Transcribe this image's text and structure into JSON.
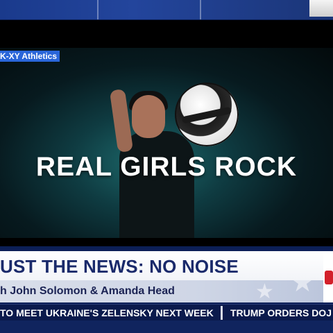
{
  "video": {
    "source_tag": "K-XY Athletics",
    "headline": "REAL GIRLS ROCK"
  },
  "lower_third": {
    "show_title": "UST THE NEWS: NO NOISE",
    "hosts": "h John Solomon & Amanda Head"
  },
  "ticker": {
    "item_1": "TO MEET UKRAINE'S ZELENSKY NEXT WEEK",
    "item_2": "TRUMP ORDERS DOJ"
  },
  "colors": {
    "brand_navy": "#0b1f56",
    "headline_text": "#1a2a6b",
    "tag_blue": "#2a66d9",
    "logo_red": "#d3202a"
  },
  "icons": [
    "star-icon",
    "network-logo-icon"
  ]
}
